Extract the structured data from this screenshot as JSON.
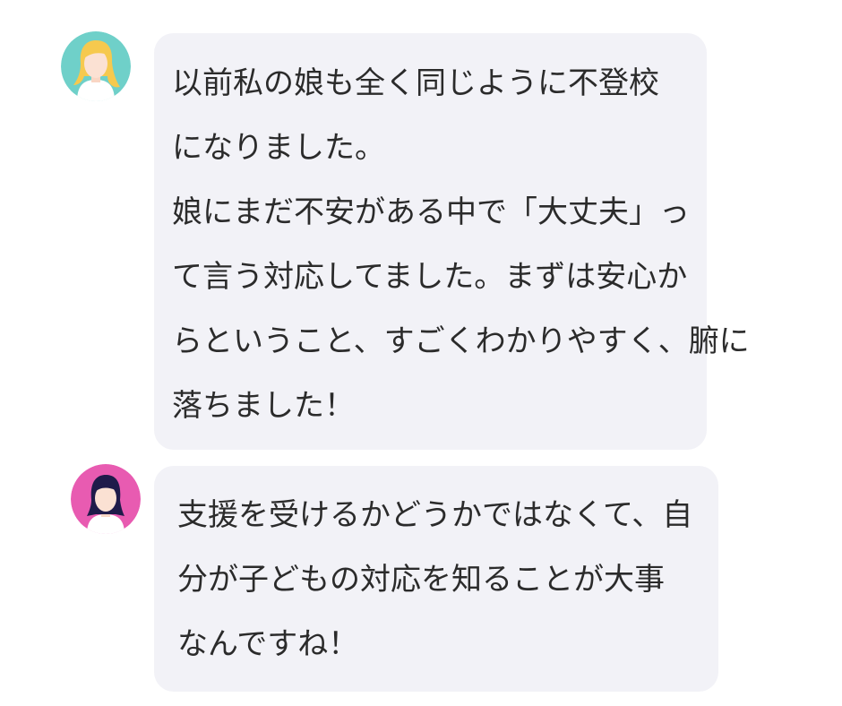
{
  "messages": [
    {
      "sender": "user-blonde",
      "avatar_bg": "#6fd0c9",
      "lines": [
        "以前私の娘も全く同じように不登校",
        "になりました。",
        "娘にまだ不安がある中で「大丈夫」っ",
        "て言う対応してました。まずは安心か",
        "らということ、すごくわかりやすく、腑に",
        "落ちました！"
      ]
    },
    {
      "sender": "user-darkhair",
      "avatar_bg": "#e85bb1",
      "lines": [
        "支援を受けるかどうかではなくて、自",
        "分が子どもの対応を知ることが大事",
        "なんですね！"
      ]
    }
  ]
}
